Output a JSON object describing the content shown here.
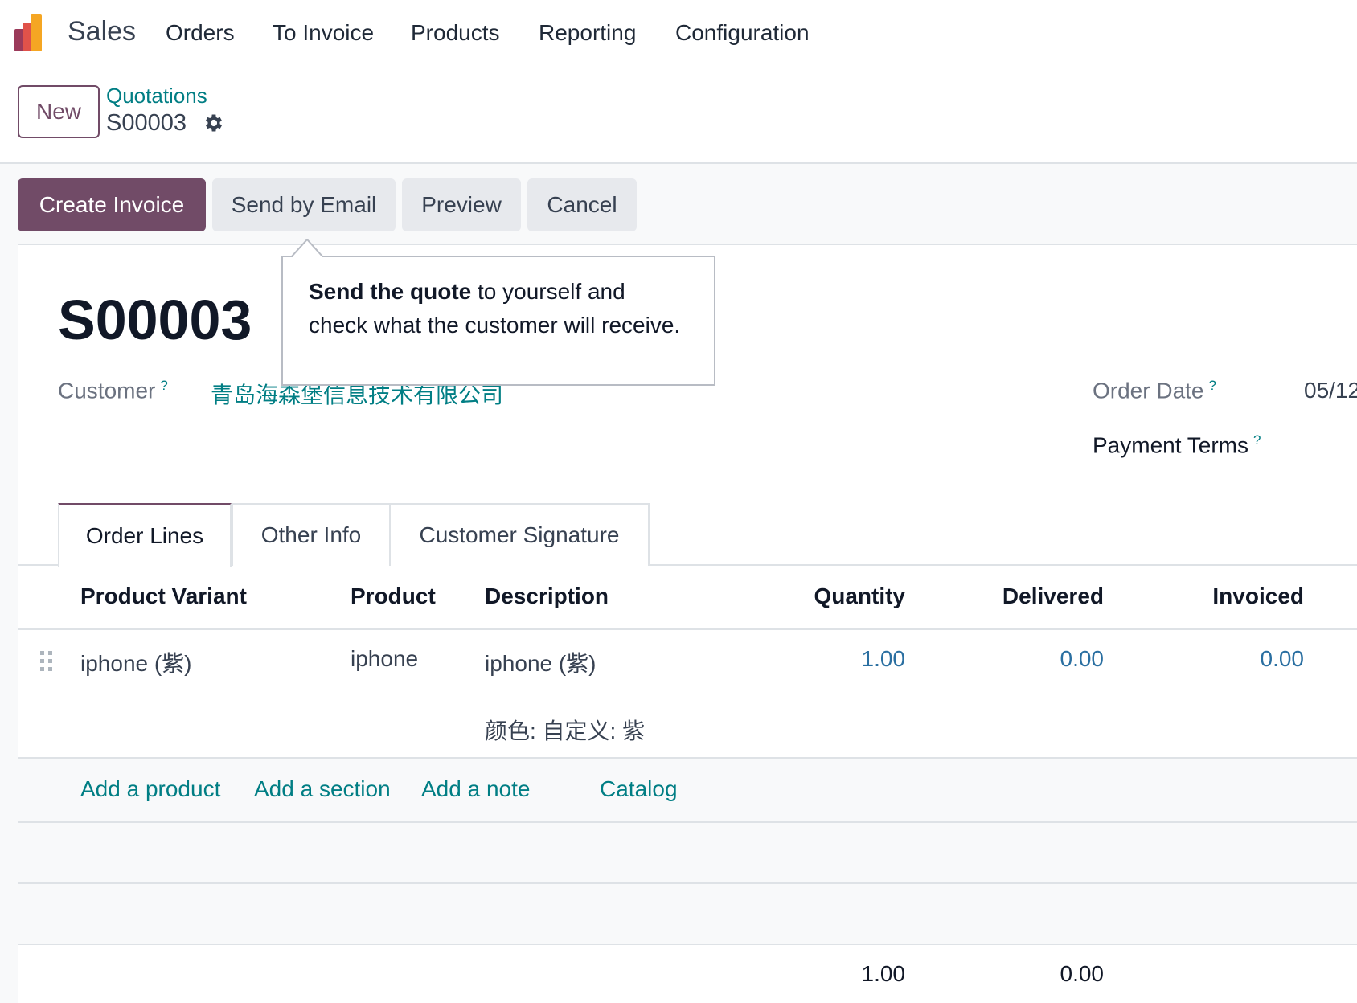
{
  "app": {
    "name": "Sales"
  },
  "menu": [
    "Orders",
    "To Invoice",
    "Products",
    "Reporting",
    "Configuration"
  ],
  "control": {
    "new_label": "New",
    "breadcrumb_parent": "Quotations",
    "breadcrumb_current": "S00003"
  },
  "actions": {
    "create_invoice": "Create Invoice",
    "send_by_email": "Send by Email",
    "preview": "Preview",
    "cancel": "Cancel"
  },
  "tooltip": {
    "bold": "Send the quote",
    "text": " to yourself and check what the customer will receive."
  },
  "record": {
    "title": "S00003",
    "customer_label": "Customer",
    "customer_value": "青岛海森堡信息技术有限公司",
    "order_date_label": "Order Date",
    "order_date_value": "05/12",
    "payment_terms_label": "Payment Terms",
    "help_mark": "?"
  },
  "tabs": [
    "Order Lines",
    "Other Info",
    "Customer Signature"
  ],
  "table": {
    "headers": [
      "Product Variant",
      "Product",
      "Description",
      "Quantity",
      "Delivered",
      "Invoiced"
    ],
    "rows": [
      {
        "variant": "iphone (紫)",
        "product": "iphone",
        "description_line1": "iphone (紫)",
        "description_line2": "颜色: 自定义: 紫",
        "quantity": "1.00",
        "delivered": "0.00",
        "invoiced": "0.00"
      }
    ],
    "add_links": [
      "Add a product",
      "Add a section",
      "Add a note",
      "Catalog"
    ],
    "totals": {
      "quantity": "1.00",
      "delivered": "0.00"
    }
  },
  "colors": {
    "brand": "#714b67",
    "link": "#017e84",
    "number": "#2a6fa1"
  }
}
